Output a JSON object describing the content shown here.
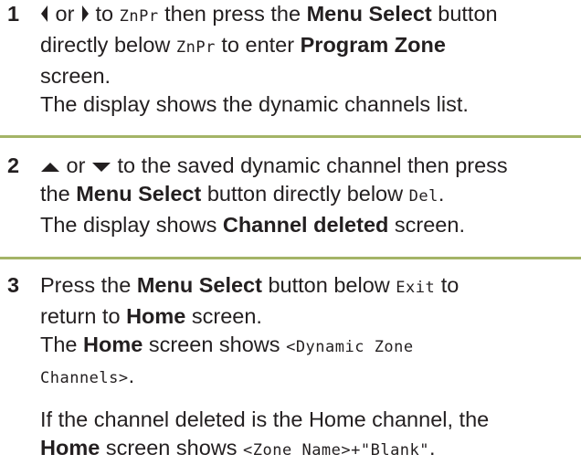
{
  "colors": {
    "separator": "#a4b467",
    "text": "#231f20"
  },
  "step1": {
    "number": "1",
    "or": "or",
    "to": "to",
    "code_znpr": "ZnPr",
    "then_press_the": "then press the",
    "menu_select": "Menu Select",
    "button": "button",
    "directly_below": "directly below",
    "code_znpr_2": "ZnPr",
    "to_enter": "to enter",
    "program_zone": "Program Zone",
    "screen_period": "screen.",
    "display_note": "The display shows the dynamic channels list.",
    "icons": [
      "left-arrow-icon",
      "right-arrow-icon"
    ]
  },
  "step2": {
    "number": "2",
    "or": "or",
    "line1_rest": "to the saved dynamic channel then press",
    "the": "the",
    "menu_select": "Menu Select",
    "button_directly_below": "button directly below",
    "code_del": "Del",
    "period": ".",
    "display_prefix": "The display shows",
    "channel_deleted": "Channel deleted",
    "screen_period": "screen.",
    "icons": [
      "up-arrow-icon",
      "down-arrow-icon"
    ]
  },
  "step3": {
    "number": "3",
    "press_the": "Press the",
    "menu_select": "Menu Select",
    "button_below": "button below",
    "code_exit": "Exit",
    "to": "to",
    "return_to": "return to",
    "home": "Home",
    "screen_period": "screen.",
    "the": "The",
    "home_2": "Home",
    "screen_shows": "screen shows",
    "code_dynamic_1": "<Dynamic Zone",
    "code_dynamic_2": "Channels>",
    "period": ".",
    "note_line1": "If the channel deleted is the Home channel, the",
    "home_3": "Home",
    "screen_shows_2": "screen shows",
    "code_zone_name": "<Zone Name>+\"Blank\"",
    "period_2": "."
  }
}
